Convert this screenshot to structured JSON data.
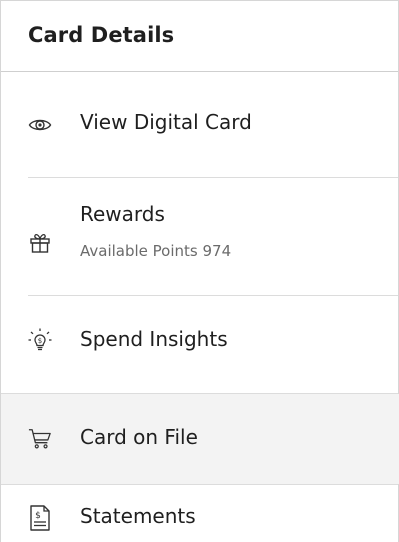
{
  "panel": {
    "title": "Card Details"
  },
  "items": [
    {
      "label": "View Digital Card",
      "icon": "eye-icon"
    },
    {
      "label": "Rewards",
      "sublabel": "Available Points 974",
      "icon": "gift-icon"
    },
    {
      "label": "Spend Insights",
      "icon": "lightbulb-dollar-icon"
    },
    {
      "label": "Card on File",
      "icon": "shopping-cart-icon",
      "selected": true
    },
    {
      "label": "Statements",
      "icon": "statement-document-icon"
    }
  ],
  "colors": {
    "text": "#1f1f1f",
    "muted": "#6b6b6b",
    "divider": "#dcdcdc",
    "selected_bg": "#f3f3f3"
  }
}
